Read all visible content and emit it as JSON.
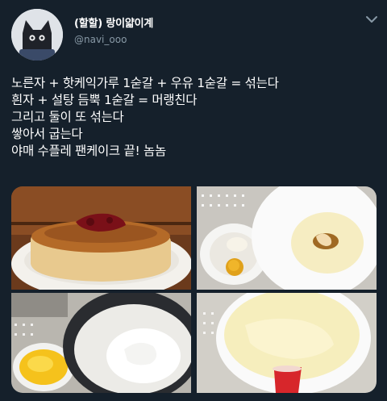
{
  "tweet": {
    "author": {
      "display_name": "(할할) 랑이얇이계",
      "handle": "@navi_ooo"
    },
    "text_lines": [
      "노른자 + 핫케익가루 1숟갈 + 우유 1숟갈 = 섞는다",
      "흰자 + 설탕 듬뿍 1숟갈 = 머랭친다",
      "그리고 둘이 또 섞는다",
      "쌓아서 굽는다",
      "야매 수플레 팬케이크 끝! 놈놈"
    ],
    "icons": {
      "menu": "chevron-down-icon",
      "avatar": "cat-avatar"
    },
    "colors": {
      "background": "#15202b",
      "text": "#ffffff",
      "secondary_text": "#8899a6"
    }
  }
}
